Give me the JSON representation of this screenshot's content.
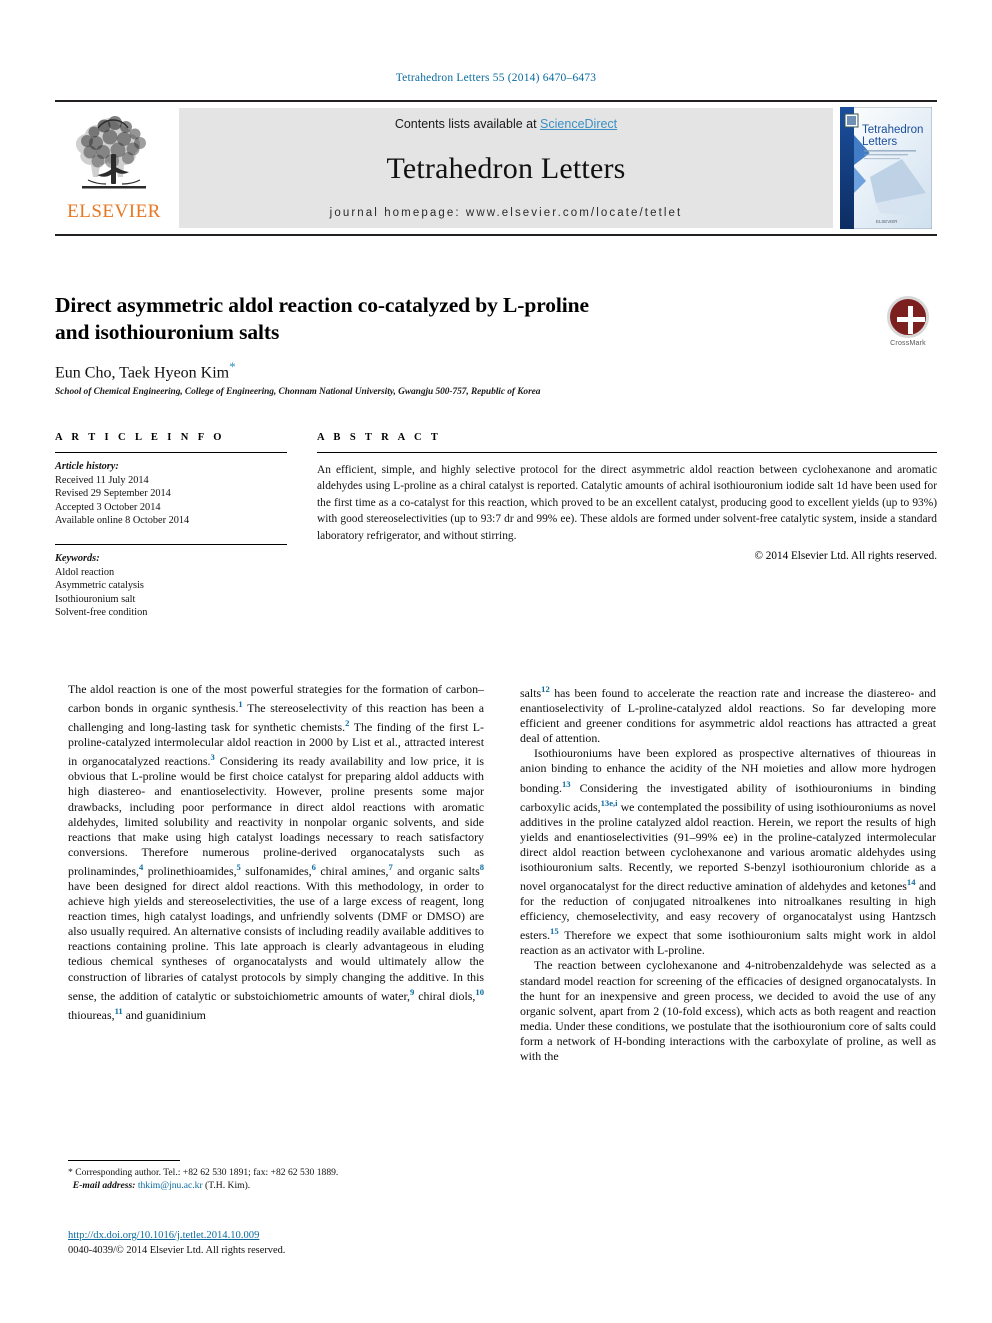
{
  "running_head": "Tetrahedron Letters 55 (2014) 6470–6473",
  "masthead": {
    "publisher_name": "ELSEVIER",
    "contents_prefix": "Contents lists available at ",
    "sciencedirect_link": "ScienceDirect",
    "journal_title": "Tetrahedron Letters",
    "homepage_line": "journal homepage: www.elsevier.com/locate/tetlet",
    "cover_title_line1": "Tetrahedron",
    "cover_title_line2": "Letters",
    "cover_publisher": "ELSEVIER"
  },
  "article": {
    "title_line1": "Direct asymmetric aldol reaction co-catalyzed by L-proline",
    "title_line2": "and isothiouronium salts",
    "title_smallcap": "L",
    "authors": "Eun Cho, Taek Hyeon Kim",
    "author_star": "*",
    "affiliation": "School of Chemical Engineering, College of Engineering, Chonnam National University, Gwangju 500-757, Republic of Korea",
    "crossmark_label": "CrossMark"
  },
  "article_info": {
    "heading": "A R T I C L E   I N F O",
    "history_label": "Article history:",
    "history": [
      "Received 11 July 2014",
      "Revised 29 September 2014",
      "Accepted 3 October 2014",
      "Available online 8 October 2014"
    ],
    "keywords_label": "Keywords:",
    "keywords": [
      "Aldol reaction",
      "Asymmetric catalysis",
      "Isothiouronium salt",
      "Solvent-free condition"
    ]
  },
  "abstract": {
    "heading": "A B S T R A C T",
    "text": "An efficient, simple, and highly selective protocol for the direct asymmetric aldol reaction between cyclohexanone and aromatic aldehydes using L-proline as a chiral catalyst is reported. Catalytic amounts of achiral isothiouronium iodide salt 1d have been used for the first time as a co-catalyst for this reaction, which proved to be an excellent catalyst, producing good to excellent yields (up to 93%) with good stereoselectivities (up to 93:7 dr and 99% ee). These aldols are formed under solvent-free catalytic system, inside a standard laboratory refrigerator, and without stirring.",
    "copyright": "© 2014 Elsevier Ltd. All rights reserved."
  },
  "body": {
    "left_p1_a": "The aldol reaction is one of the most powerful strategies for the formation of carbon–carbon bonds in organic synthesis.",
    "left_p1_r1": "1",
    "left_p1_b": " The stereoselectivity of this reaction has been a challenging and long-lasting task for synthetic chemists.",
    "left_p1_r2": "2",
    "left_p1_c": " The finding of the first L-proline-catalyzed intermolecular aldol reaction in 2000 by List et al., attracted interest in organocatalyzed reactions.",
    "left_p1_r3": "3",
    "left_p1_d": " Considering its ready availability and low price, it is obvious that L-proline would be first choice catalyst for preparing aldol adducts with high diastereo- and enantioselectivity. However, proline presents some major drawbacks, including poor performance in direct aldol reactions with aromatic aldehydes, limited solubility and reactivity in nonpolar organic solvents, and side reactions that make using high catalyst loadings necessary to reach satisfactory conversions. Therefore numerous proline-derived organocatalysts such as prolinamindes,",
    "left_p1_r4": "4",
    "left_p1_e": " prolinethioamides,",
    "left_p1_r5": "5",
    "left_p1_f": " sulfonamides,",
    "left_p1_r6": "6",
    "left_p1_g": " chiral amines,",
    "left_p1_r7": "7",
    "left_p1_h": " and organic salts",
    "left_p1_r8": "8",
    "left_p1_i": " have been designed for direct aldol reactions. With this methodology, in order to achieve high yields and stereoselectivities, the use of a large excess of reagent, long reaction times, high catalyst loadings, and unfriendly solvents (DMF or DMSO) are also usually required. An alternative consists of including readily available additives to reactions containing proline. This late approach is clearly advantageous in eluding tedious chemical syntheses of organocatalysts and would ultimately allow the construction of libraries of catalyst protocols by simply changing the additive. In this sense, the addition of catalytic or substoichiometric amounts of water,",
    "left_p1_r9": "9",
    "left_p1_j": " chiral diols,",
    "left_p1_r10": "10",
    "left_p1_k": " thioureas,",
    "left_p1_r11": "11",
    "left_p1_l": " and guanidinium",
    "right_p1_a": "salts",
    "right_p1_r12": "12",
    "right_p1_b": " has been found to accelerate the reaction rate and increase the diastereo- and enantioselectivity of L-proline-catalyzed aldol reactions. So far developing more efficient and greener conditions for asymmetric aldol reactions has attracted a great deal of attention.",
    "right_p2_a": "Isothiouroniums have been explored as prospective alternatives of thioureas in anion binding to enhance the acidity of the NH moieties and allow more hydrogen bonding.",
    "right_p2_r13": "13",
    "right_p2_b": " Considering the investigated ability of isothiouroniums in binding carboxylic acids,",
    "right_p2_r13ei": "13e,i",
    "right_p2_c": " we contemplated the possibility of using isothiouroniums as novel additives in the proline catalyzed aldol reaction. Herein, we report the results of high yields and enantioselectivities (91–99% ee) in the proline-catalyzed intermolecular direct aldol reaction between cyclohexanone and various aromatic aldehydes using isothiouronium salts. Recently, we reported S-benzyl isothiouronium chloride as a novel organocatalyst for the direct reductive amination of aldehydes and ketones",
    "right_p2_r14": "14",
    "right_p2_d": " and for the reduction of conjugated nitroalkenes into nitroalkanes resulting in high efficiency, chemoselectivity, and easy recovery of organocatalyst using Hantzsch esters.",
    "right_p2_r15": "15",
    "right_p2_e": " Therefore we expect that some isothiouronium salts might work in aldol reaction as an activator with L-proline.",
    "right_p3": "The reaction between cyclohexanone and 4-nitrobenzaldehyde was selected as a standard model reaction for screening of the efficacies of designed organocatalysts. In the hunt for an inexpensive and green process, we decided to avoid the use of any organic solvent, apart from 2 (10-fold excess), which acts as both reagent and reaction media. Under these conditions, we postulate that the isothiouronium core of salts could form a network of H-bonding interactions with the carboxylate of proline, as well as with the"
  },
  "footnote": {
    "star": "*",
    "corresponding": "Corresponding author. Tel.: +82 62 530 1891; fax: +82 62 530 1889.",
    "email_label": "E-mail address:",
    "email": "thkim@jnu.ac.kr",
    "email_owner": "(T.H. Kim)."
  },
  "footer": {
    "doi": "http://dx.doi.org/10.1016/j.tetlet.2014.10.009",
    "copyright": "0040-4039/© 2014 Elsevier Ltd. All rights reserved."
  },
  "colors": {
    "link_blue": "#0b6ba0",
    "elsevier_orange": "#e87722",
    "band_gray": "#e4e4e4",
    "crossmark_red": "#7b1f1f"
  }
}
